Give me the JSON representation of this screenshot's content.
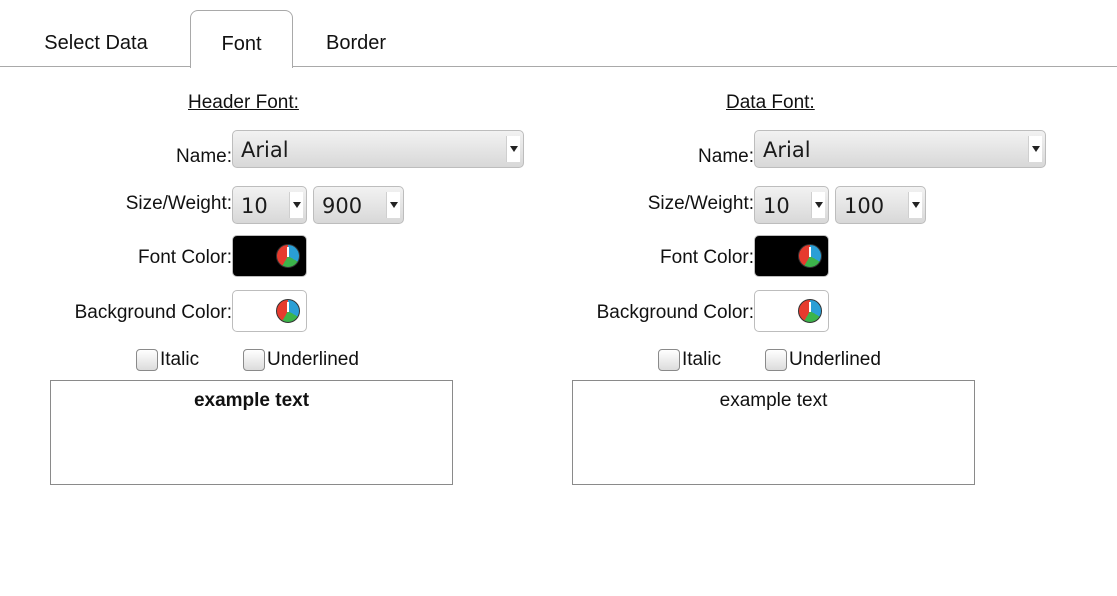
{
  "tabs": [
    {
      "label": "Select Data"
    },
    {
      "label": "Font",
      "active": true
    },
    {
      "label": "Border"
    }
  ],
  "header_font": {
    "title": "Header Font:",
    "name_label": "Name:",
    "name_value": "Arial",
    "size_weight_label": "Size/Weight:",
    "size_value": "10",
    "weight_value": "900",
    "font_color_label": "Font Color:",
    "font_color": "#000000",
    "bg_color_label": "Background Color:",
    "bg_color": "#ffffff",
    "italic_label": "Italic",
    "underlined_label": "Underlined",
    "italic_checked": false,
    "underlined_checked": false,
    "example_text": "example text"
  },
  "data_font": {
    "title": "Data Font:",
    "name_label": "Name:",
    "name_value": "Arial",
    "size_weight_label": "Size/Weight:",
    "size_value": "10",
    "weight_value": "100",
    "font_color_label": "Font Color:",
    "font_color": "#000000",
    "bg_color_label": "Background Color:",
    "bg_color": "#ffffff",
    "italic_label": "Italic",
    "underlined_label": "Underlined",
    "italic_checked": false,
    "underlined_checked": false,
    "example_text": "example text"
  }
}
